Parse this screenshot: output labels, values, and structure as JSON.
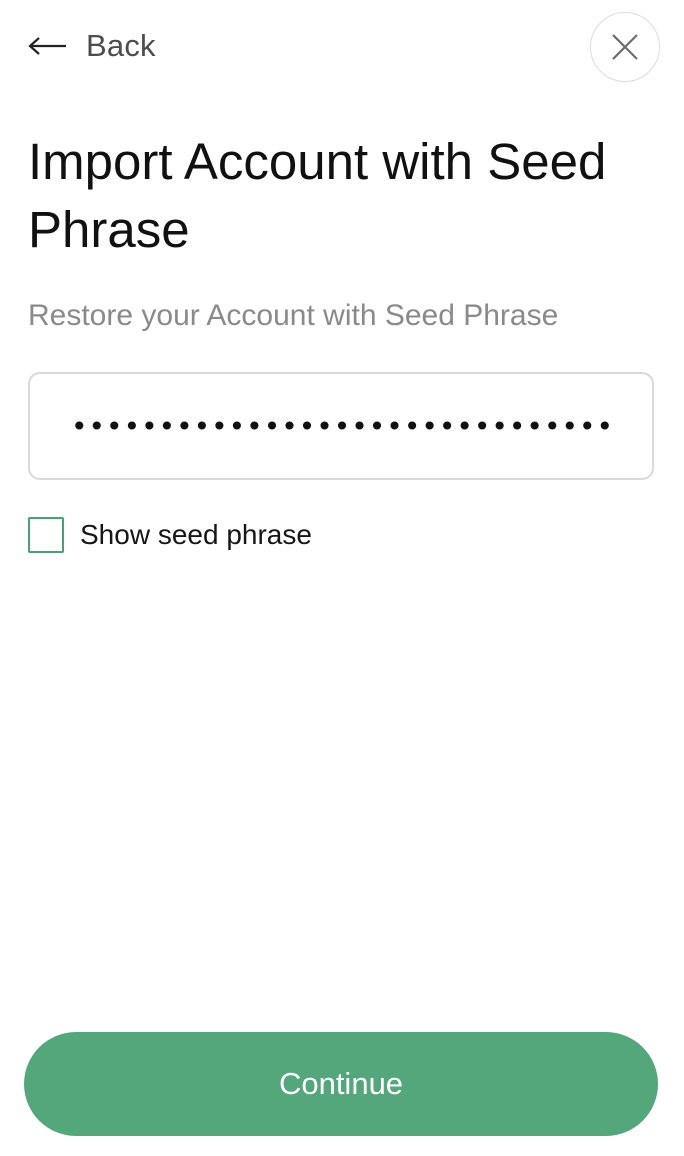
{
  "header": {
    "back_label": "Back",
    "back_icon": "arrow-left-icon",
    "close_icon": "close-icon"
  },
  "title": "Import Account with Seed Phrase",
  "subtitle": "Restore your Account with Seed Phrase",
  "seed_input": {
    "value": "abandon ability able about above absent absorb abstract absurd abuse access",
    "type": "password"
  },
  "show_seed": {
    "label": "Show seed phrase",
    "checked": false
  },
  "continue_label": "Continue",
  "colors": {
    "accent": "#54a67b",
    "checkbox_border": "#4e9e73",
    "subtitle": "#8a8a8a",
    "input_border": "#d9d9d9"
  }
}
